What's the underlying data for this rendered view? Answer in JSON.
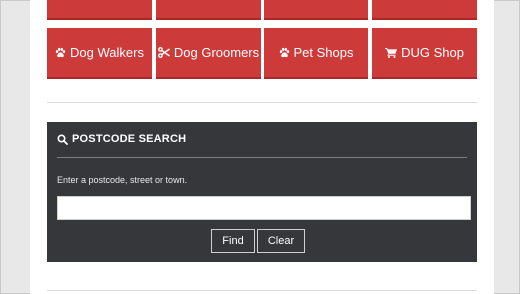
{
  "tiles_top_row": [
    {
      "label": ""
    },
    {
      "label": ""
    },
    {
      "label": ""
    },
    {
      "label": ""
    }
  ],
  "tiles": [
    {
      "label": "Dog Walkers",
      "icon": "paw-icon"
    },
    {
      "label": "Dog Groomers",
      "icon": "scissors-icon"
    },
    {
      "label": "Pet Shops",
      "icon": "paw-icon"
    },
    {
      "label": "DUG Shop",
      "icon": "shopping-cart-icon"
    }
  ],
  "postcode_search": {
    "title": "POSTCODE SEARCH",
    "title_icon": "search-icon",
    "hint": "Enter a postcode, street or town.",
    "input_value": "",
    "input_placeholder": "",
    "find_label": "Find",
    "clear_label": "Clear"
  },
  "colors": {
    "tile_red": "#cd3a3a",
    "panel_dark": "#35373a",
    "page_bg": "#ffffff",
    "outer_bg": "#e8e8e8"
  }
}
